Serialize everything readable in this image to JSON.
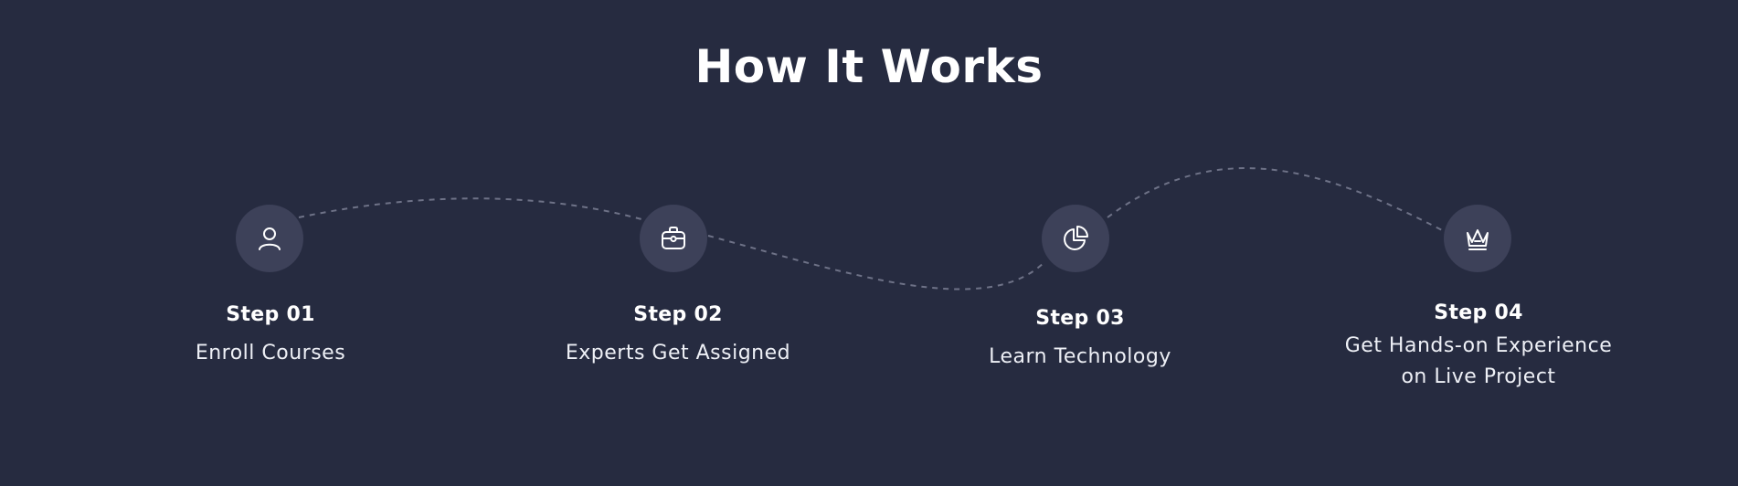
{
  "section": {
    "title": "How It Works"
  },
  "colors": {
    "background": "#262b40",
    "icon_circle": "#3d4159",
    "dashed_path": "#6e7287",
    "text": "#ffffff"
  },
  "steps": [
    {
      "label": "Step 01",
      "description": "Enroll Courses",
      "icon": "user-icon"
    },
    {
      "label": "Step 02",
      "description": "Experts Get Assigned",
      "icon": "briefcase-icon"
    },
    {
      "label": "Step 03",
      "description": "Learn Technology",
      "icon": "pie-chart-icon"
    },
    {
      "label": "Step 04",
      "description_line1": "Get Hands-on Experience",
      "description_line2": "on Live Project",
      "icon": "crown-icon"
    }
  ]
}
